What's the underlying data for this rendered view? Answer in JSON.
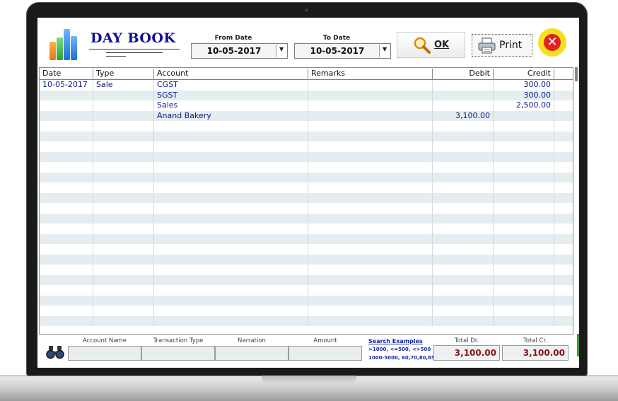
{
  "header": {
    "title": "DAY BOOK",
    "from_label": "From Date",
    "from_value": "10-05-2017",
    "to_label": "To Date",
    "to_value": "10-05-2017",
    "ok_label": "OK",
    "print_label": "Print"
  },
  "grid": {
    "columns": [
      "Date",
      "Type",
      "Account",
      "Remarks",
      "Debit",
      "Credit"
    ],
    "rows": [
      {
        "date": "10-05-2017",
        "type": "Sale",
        "account": "CGST",
        "remarks": "",
        "debit": "",
        "credit": "300.00"
      },
      {
        "date": "",
        "type": "",
        "account": "SGST",
        "remarks": "",
        "debit": "",
        "credit": "300.00"
      },
      {
        "date": "",
        "type": "",
        "account": "Sales",
        "remarks": "",
        "debit": "",
        "credit": "2,500.00"
      },
      {
        "date": "",
        "type": "",
        "account": "Anand Bakery",
        "remarks": "",
        "debit": "3,100.00",
        "credit": ""
      }
    ]
  },
  "search": {
    "account_name_label": "Account Name",
    "transaction_type_label": "Transaction Type",
    "narration_label": "Narration",
    "amount_label": "Amount",
    "examples_title": "Search Examples",
    "examples_line1": ">1000,  <=500,  <>500",
    "examples_line2": "1000-5000,    60,70,80,85"
  },
  "totals": {
    "dr_label": "Total Dr.",
    "dr_value": "3,100.00",
    "cr_label": "Total Cr.",
    "cr_value": "3,100.00"
  },
  "colors": {
    "title": "#0d0d9a",
    "row_text": "#0a1a8c",
    "total_text": "#8a1313",
    "row_alt": "#e6edf0",
    "close_button": "#f4e01b"
  }
}
